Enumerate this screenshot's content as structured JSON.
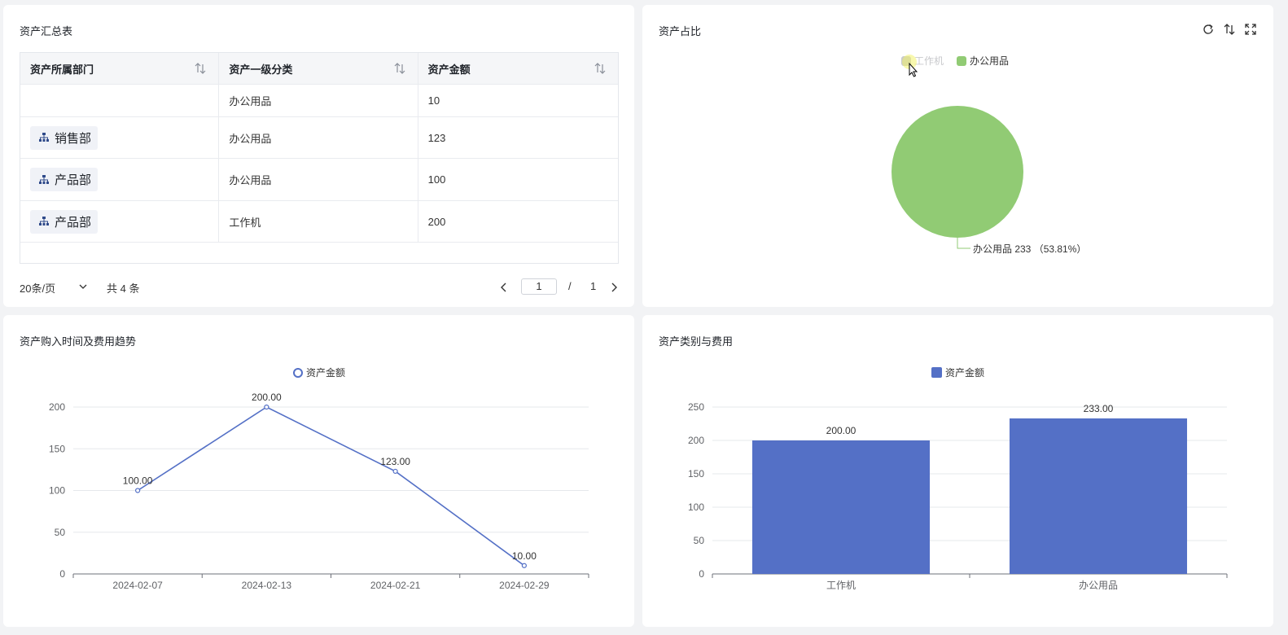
{
  "table_card": {
    "title": "资产汇总表",
    "columns": [
      "资产所属部门",
      "资产一级分类",
      "资产金额"
    ],
    "rows": [
      {
        "dept": "",
        "category": "办公用品",
        "amount": "10"
      },
      {
        "dept": "销售部",
        "category": "办公用品",
        "amount": "123"
      },
      {
        "dept": "产品部",
        "category": "办公用品",
        "amount": "100"
      },
      {
        "dept": "产品部",
        "category": "工作机",
        "amount": "200"
      }
    ],
    "pager": {
      "page_size": "20条/页",
      "total": "共 4 条",
      "current_page": "1",
      "slash": "/",
      "total_pages": "1"
    }
  },
  "pie_card": {
    "title": "资产占比",
    "tools": [
      "refresh-icon",
      "sort-icon",
      "fullscreen-icon"
    ]
  },
  "line_card": {
    "title": "资产购入时间及费用趋势"
  },
  "bar_card": {
    "title": "资产类别与费用"
  },
  "chart_data": [
    {
      "type": "pie",
      "legend": [
        "工作机",
        "办公用品"
      ],
      "legend_state": {
        "工作机": "hidden",
        "办公用品": "visible"
      },
      "slices": [
        {
          "name": "办公用品",
          "value": 233,
          "percent": "53.81%",
          "color": "#91cb74"
        }
      ],
      "slice_label": "办公用品 233 （53.81%）",
      "legend_colors": {
        "工作机": "#c8c9cc",
        "办公用品": "#91cb74"
      }
    },
    {
      "type": "line",
      "legend": [
        "资产金额"
      ],
      "x": [
        "2024-02-07",
        "2024-02-13",
        "2024-02-21",
        "2024-02-29"
      ],
      "series": [
        {
          "name": "资产金额",
          "values": [
            100,
            200,
            123,
            10
          ],
          "labels": [
            "100.00",
            "200.00",
            "123.00",
            "10.00"
          ],
          "color": "#5470c6"
        }
      ],
      "yticks": [
        "0",
        "50",
        "100",
        "150",
        "200"
      ],
      "ylim": [
        0,
        200
      ],
      "grid": true
    },
    {
      "type": "bar",
      "legend": [
        "资产金额"
      ],
      "categories": [
        "工作机",
        "办公用品"
      ],
      "series": [
        {
          "name": "资产金额",
          "values": [
            200,
            233
          ],
          "labels": [
            "200.00",
            "233.00"
          ],
          "color": "#5470c6"
        }
      ],
      "yticks": [
        "0",
        "50",
        "100",
        "150",
        "200",
        "250"
      ],
      "ylim": [
        0,
        250
      ],
      "grid": true
    }
  ]
}
